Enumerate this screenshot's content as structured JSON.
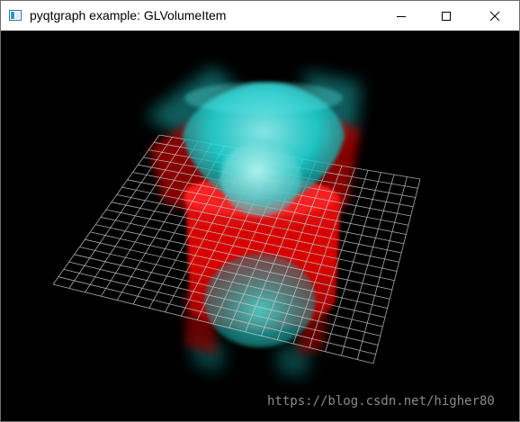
{
  "window": {
    "title": "pyqtgraph example: GLVolumeItem",
    "icon": "app-window-icon",
    "controls": {
      "minimize": "minimize-icon",
      "maximize": "maximize-icon",
      "close": "close-icon"
    }
  },
  "scene": {
    "background": "#000000",
    "grid_color": "#c8c8c8",
    "colors": {
      "cyan": "#22dede",
      "red": "#ff1010"
    }
  },
  "watermark": {
    "text": "https://blog.csdn.net/higher80"
  }
}
